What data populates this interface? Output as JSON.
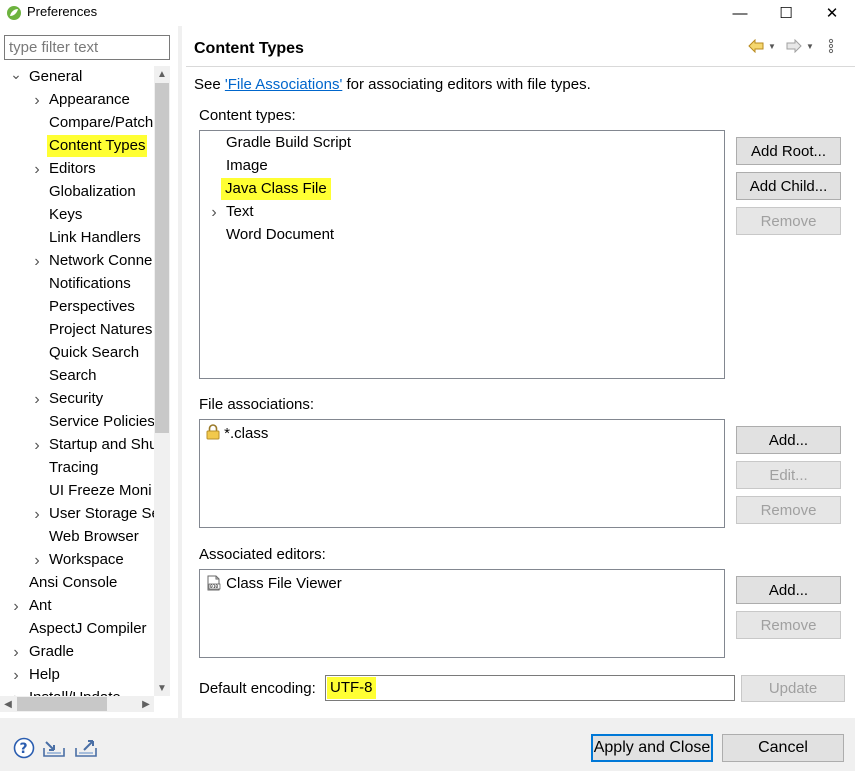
{
  "window": {
    "title": "Preferences",
    "minimize": "—",
    "maximize": "☐",
    "close": "✕"
  },
  "filter": {
    "placeholder": "type filter text"
  },
  "tree": {
    "items": [
      {
        "label": "General",
        "arrow": "expanded"
      },
      {
        "label": "Appearance",
        "arrow": "collapsed"
      },
      {
        "label": "Compare/Patch",
        "arrow": "none"
      },
      {
        "label": "Content Types",
        "arrow": "none",
        "selected": true
      },
      {
        "label": "Editors",
        "arrow": "collapsed"
      },
      {
        "label": "Globalization",
        "arrow": "none"
      },
      {
        "label": "Keys",
        "arrow": "none"
      },
      {
        "label": "Link Handlers",
        "arrow": "none"
      },
      {
        "label": "Network Conne",
        "arrow": "collapsed"
      },
      {
        "label": "Notifications",
        "arrow": "none"
      },
      {
        "label": "Perspectives",
        "arrow": "none"
      },
      {
        "label": "Project Natures",
        "arrow": "none"
      },
      {
        "label": "Quick Search",
        "arrow": "none"
      },
      {
        "label": "Search",
        "arrow": "none"
      },
      {
        "label": "Security",
        "arrow": "collapsed"
      },
      {
        "label": "Service Policies",
        "arrow": "none"
      },
      {
        "label": "Startup and Shu",
        "arrow": "collapsed"
      },
      {
        "label": "Tracing",
        "arrow": "none"
      },
      {
        "label": "UI Freeze Moni",
        "arrow": "none"
      },
      {
        "label": "User Storage Se",
        "arrow": "collapsed"
      },
      {
        "label": "Web Browser",
        "arrow": "none"
      },
      {
        "label": "Workspace",
        "arrow": "collapsed"
      },
      {
        "label": "Ansi Console",
        "arrow": "none"
      },
      {
        "label": "Ant",
        "arrow": "collapsed"
      },
      {
        "label": "AspectJ Compiler",
        "arrow": "none"
      },
      {
        "label": "Gradle",
        "arrow": "collapsed"
      },
      {
        "label": "Help",
        "arrow": "collapsed"
      },
      {
        "label": "Install/Update",
        "arrow": "collapsed"
      }
    ]
  },
  "page": {
    "title": "Content Types",
    "desc_prefix": "See ",
    "desc_link": "'File Associations'",
    "desc_suffix": " for associating editors with file types.",
    "content_types_label": "Content types:",
    "content_types": [
      {
        "label": "Gradle Build Script",
        "arrow": "none"
      },
      {
        "label": "Image",
        "arrow": "none"
      },
      {
        "label": "Java Class File",
        "arrow": "none",
        "selected": true
      },
      {
        "label": "Text",
        "arrow": "collapsed"
      },
      {
        "label": "Word Document",
        "arrow": "none"
      }
    ],
    "add_root": "Add Root...",
    "add_child": "Add Child...",
    "remove_ct": "Remove",
    "file_assoc_label": "File associations:",
    "file_assocs": [
      "*.class"
    ],
    "add_fa": "Add...",
    "edit_fa": "Edit...",
    "remove_fa": "Remove",
    "assoc_editors_label": "Associated editors:",
    "assoc_editors": [
      "Class File Viewer"
    ],
    "add_ed": "Add...",
    "remove_ed": "Remove",
    "encoding_label": "Default encoding:",
    "encoding_value": "UTF-8",
    "update": "Update"
  },
  "footer": {
    "apply_close": "Apply and Close",
    "cancel": "Cancel"
  },
  "colors": {
    "highlight": "#ffff33",
    "link": "#0066cc",
    "default_border": "#0078d7"
  }
}
